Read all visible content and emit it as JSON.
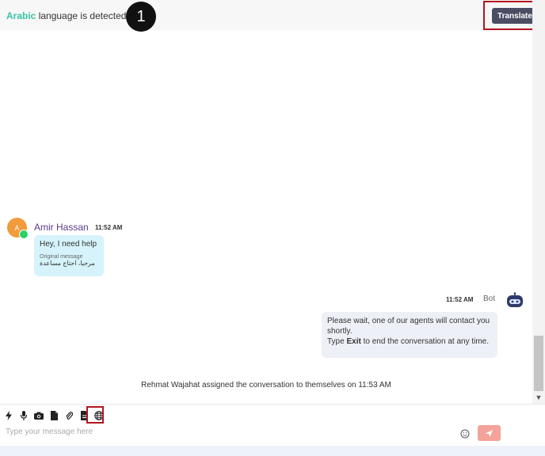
{
  "header": {
    "detected_language": "Arabic",
    "detected_suffix": " language is detected",
    "step_number": "1",
    "translate_label": "Translate"
  },
  "messages": {
    "user": {
      "avatar_initial": "A",
      "name": "Amir Hassan",
      "time": "11:52 AM",
      "text": "Hey, I need help",
      "original_label": "Original message",
      "original_text": "مرحبا، احتاج مساعدة"
    },
    "bot": {
      "time": "11:52 AM",
      "name": "Bot",
      "line1": "Please wait, one of our agents will contact you shortly.",
      "line2_prefix": "Type ",
      "line2_bold": "Exit",
      "line2_suffix": " to end the conversation at any time."
    },
    "system": "Rehmat Wajahat assigned the conversation to themselves on 11:53 AM"
  },
  "composer": {
    "placeholder": "Type your message here",
    "tools": [
      "lightning-icon",
      "microphone-icon",
      "camera-icon",
      "document-icon",
      "paperclip-icon",
      "file-icon",
      "globe-icon"
    ]
  },
  "colors": {
    "accent_language": "#39c3a6",
    "translate_button": "#4b4d63",
    "highlight_box": "#b3141f",
    "user_name": "#5b3a8e",
    "incoming_bubble": "#d6f3fb",
    "outgoing_bubble": "#eef0f7",
    "send_button": "#f3a39a"
  }
}
